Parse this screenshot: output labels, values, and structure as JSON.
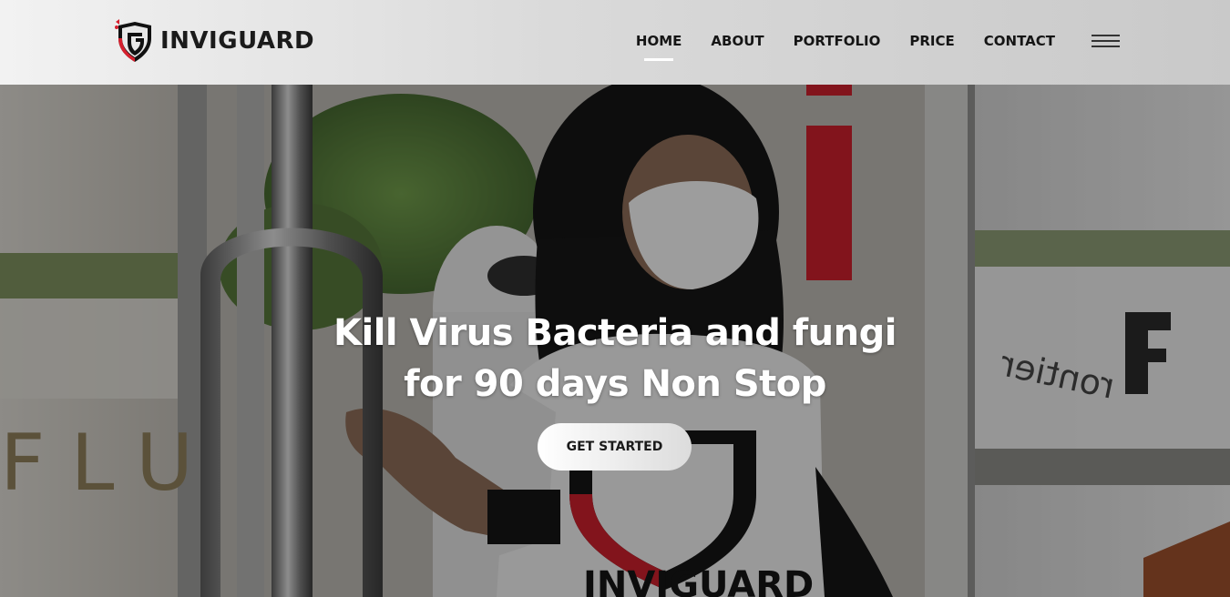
{
  "brand": {
    "name": "INVIGUARD",
    "accent_color": "#d6202e"
  },
  "nav": {
    "items": [
      {
        "label": "HOME",
        "active": true
      },
      {
        "label": "ABOUT",
        "active": false
      },
      {
        "label": "PORTFOLIO",
        "active": false
      },
      {
        "label": "PRICE",
        "active": false
      },
      {
        "label": "CONTACT",
        "active": false
      }
    ],
    "menu_icon": "hamburger-menu-icon"
  },
  "hero": {
    "title_line1": "Kill Virus Bacteria and fungi",
    "title_line2": "for 90 days Non Stop",
    "cta_label": "GET STARTED",
    "photo": {
      "door_letters": "FLU",
      "sign_text": "rontier",
      "shirt_text": "INVIGUARD"
    }
  }
}
